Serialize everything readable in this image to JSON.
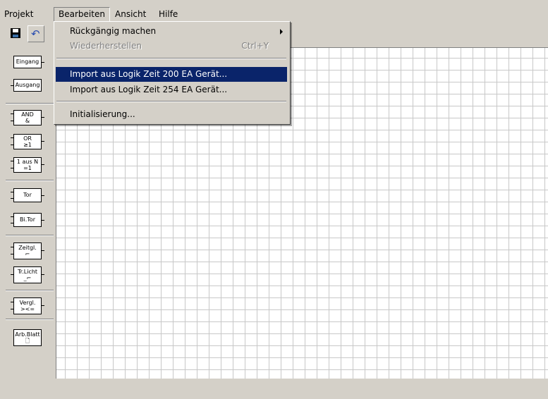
{
  "menubar": {
    "items": [
      {
        "label": "Projekt"
      },
      {
        "label": "Bearbeiten"
      },
      {
        "label": "Ansicht"
      },
      {
        "label": "Hilfe"
      }
    ]
  },
  "toolbar": {
    "save_icon": "save-icon",
    "undo_icon": "undo-icon"
  },
  "palette": {
    "blocks": [
      {
        "line1": "Eingang",
        "line2": ""
      },
      {
        "line1": "Ausgang",
        "line2": ""
      },
      {
        "line1": "AND",
        "line2": "&"
      },
      {
        "line1": "OR",
        "line2": "≥1"
      },
      {
        "line1": "1 aus N",
        "line2": "=1"
      },
      {
        "line1": "Tor",
        "line2": ""
      },
      {
        "line1": "Bi.Tor",
        "line2": ""
      },
      {
        "line1": "Zeitgl.",
        "line2": "⌐"
      },
      {
        "line1": "Tr.Licht",
        "line2": "_⌐"
      },
      {
        "line1": "Vergl.",
        "line2": "><="
      },
      {
        "line1": "Arb.Blatt",
        "line2": "🗋"
      }
    ]
  },
  "dropdown": {
    "items": [
      {
        "label": "Rückgängig machen",
        "accelerator": "",
        "state": "normal",
        "submenu": true
      },
      {
        "label": "Wiederherstellen",
        "accelerator": "Ctrl+Y",
        "state": "disabled"
      },
      {
        "label": "Import aus Logik Zeit 200 EA Gerät...",
        "accelerator": "",
        "state": "highlighted"
      },
      {
        "label": "Import aus Logik Zeit 254 EA Gerät...",
        "accelerator": "",
        "state": "normal"
      },
      {
        "label": "Initialisierung...",
        "accelerator": "",
        "state": "normal"
      }
    ]
  },
  "colors": {
    "face": "#d4d0c8",
    "highlight": "#0a246a",
    "grid": "#c8c8c8"
  }
}
